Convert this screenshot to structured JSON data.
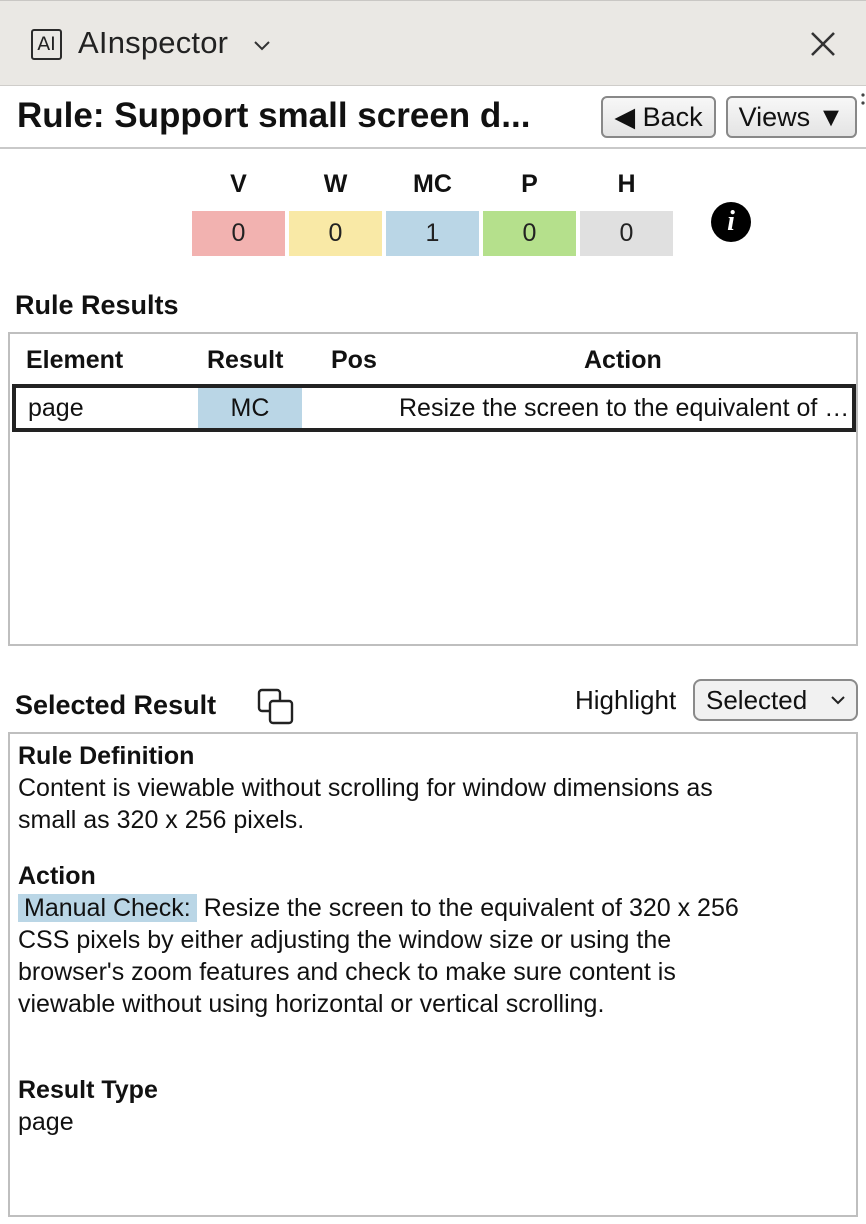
{
  "app": {
    "logo_text": "AI",
    "title": "AInspector",
    "title_chevron_icon": "chevron-down-icon",
    "close_icon": "close-icon"
  },
  "header": {
    "rule_title": "Rule: Support small screen d...",
    "back_label": "◀ Back",
    "views_label": "Views ▼"
  },
  "summary": {
    "columns": [
      {
        "label": "V",
        "value": "0",
        "color": "#f2b2b0"
      },
      {
        "label": "W",
        "value": "0",
        "color": "#f9e9a6"
      },
      {
        "label": "MC",
        "value": "1",
        "color": "#bad6e6"
      },
      {
        "label": "P",
        "value": "0",
        "color": "#b5e08c"
      },
      {
        "label": "H",
        "value": "0",
        "color": "#e0e0e0"
      }
    ],
    "info_icon": "info-icon",
    "info_glyph": "i"
  },
  "rule_results": {
    "heading": "Rule Results",
    "columns": [
      "Element",
      "Result",
      "Pos",
      "Action"
    ],
    "rows": [
      {
        "element": "page",
        "result": "MC",
        "pos": "",
        "action": "Resize the screen to the equivalent of 320 x 256 CSS pixels by either adjusting the window size or using the browser's zoom features and check to make sure content is viewable without using horizontal or vertical scrolling."
      }
    ]
  },
  "selected_result": {
    "heading": "Selected Result",
    "copy_icon": "copy-icon",
    "highlight_label": "Highlight",
    "highlight_value": "Selected",
    "rule_definition_heading": "Rule Definition",
    "rule_definition_line1": "Content is viewable without scrolling for window dimensions as",
    "rule_definition_line2": "small as 320 x 256 pixels.",
    "action_heading": "Action",
    "action_badge": "Manual Check:",
    "action_line1": " Resize the screen to the equivalent of 320 x 256",
    "action_line2": "CSS pixels by either adjusting the window size or using the",
    "action_line3": "browser's zoom features and check to make sure content is",
    "action_line4": "viewable without using horizontal or vertical scrolling.",
    "result_type_heading": "Result Type",
    "result_type_value": "page"
  }
}
